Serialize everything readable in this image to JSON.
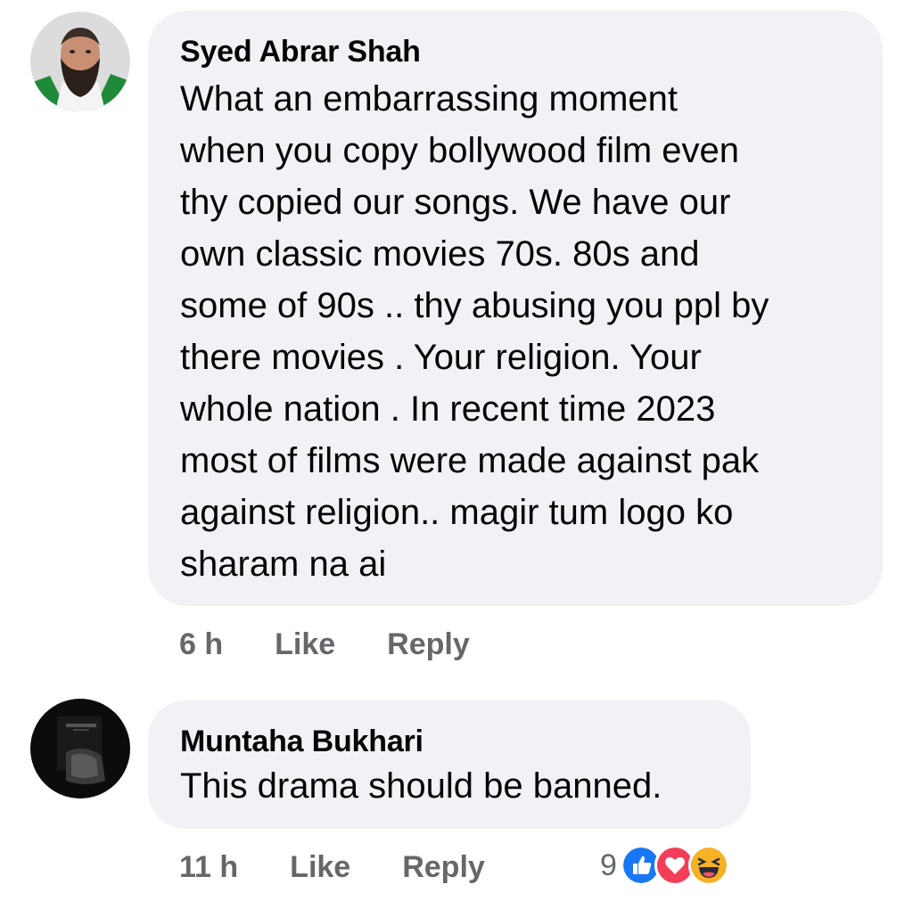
{
  "comments": [
    {
      "author": "Syed Abrar Shah",
      "lines": [
        "What an embarrassing moment",
        "when you copy bollywood film even",
        "thy copied our songs. We have our",
        "own classic movies 70s. 80s and",
        "some of 90s .. thy abusing you ppl by",
        "there movies . Your religion. Your",
        "whole nation . In recent time 2023",
        "most of films were made against pak",
        "against religion.. magir tum logo ko",
        "sharam na ai"
      ],
      "time": "6 h",
      "like_label": "Like",
      "reply_label": "Reply"
    },
    {
      "author": "Muntaha Bukhari",
      "text": "This drama should be banned.",
      "time": "11 h",
      "like_label": "Like",
      "reply_label": "Reply",
      "reaction_count": "9",
      "reactions": [
        "like-icon",
        "love-icon",
        "haha-icon"
      ]
    }
  ],
  "colors": {
    "bubble": "#f0f2f5",
    "text": "#050505",
    "secondary": "#65676b",
    "like_blue": "#1877f2",
    "love_red": "#f33e58",
    "haha_yellow": "#f7b125"
  }
}
